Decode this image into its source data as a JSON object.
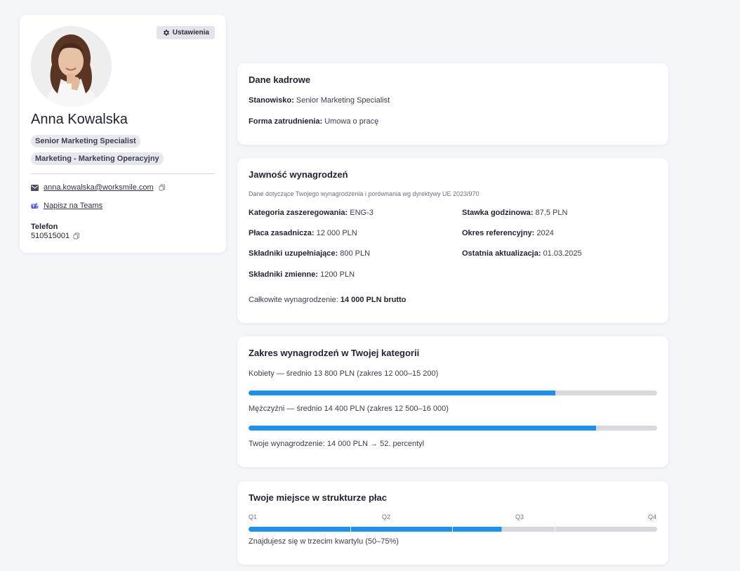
{
  "profile": {
    "settings_label": "Ustawienia",
    "name": "Anna Kowalska",
    "position_chip": "Senior Marketing Specialist",
    "department_chip": "Marketing - Marketing Operacyjny",
    "email": "anna.kowalska@worksmile.com",
    "teams_label": "Napisz na Teams",
    "phone_label": "Telefon",
    "phone": "510515001"
  },
  "hr_data": {
    "title": "Dane kadrowe",
    "position_key": "Stanowisko:",
    "position_value": "Senior Marketing Specialist",
    "employment_key": "Forma zatrudnienia:",
    "employment_value": "Umowa o pracę"
  },
  "pay_transparency": {
    "title": "Jawność wynagrodzeń",
    "note": "Dane dotyczące Twojego wynagrodzenia i porównania wg dyrektywy UE 2023/970",
    "category_key": "Kategoria zaszeregowania:",
    "category_value": "ENG-3",
    "hourly_key": "Stawka godzinowa:",
    "hourly_value": "87,5 PLN",
    "base_key": "Płaca zasadnicza:",
    "base_value": "12 000 PLN",
    "period_key": "Okres referencyjny:",
    "period_value": "2024",
    "supplementary_key": "Składniki uzupełniające:",
    "supplementary_value": "800 PLN",
    "updated_key": "Ostatnia aktualizacja:",
    "updated_value": "01.03.2025",
    "variable_key": "Składniki zmienne:",
    "variable_value": "1200 PLN",
    "total_key": "Całkowite wynagrodzenie:",
    "total_value": "14 000 PLN brutto"
  },
  "pay_range": {
    "title": "Zakres wynagrodzeń w Twojej kategorii",
    "women_label": "Kobiety — średnio 13 800 PLN (zakres 12 000–15 200)",
    "women_fill_fraction": 0.75,
    "men_label": "Mężczyźni — średnio 14 400 PLN (zakres 12 500–16 000)",
    "men_fill_fraction": 0.85,
    "yours_label": "Twoje wynagrodzenie: 14 000 PLN → 52. percentyl"
  },
  "structure": {
    "title": "Twoje miejsce w strukturze płac",
    "q1": "Q1",
    "q2": "Q2",
    "q3": "Q3",
    "q4": "Q4",
    "fill_fraction": 0.62,
    "caption": "Znajdujesz się w trzecim kwartylu (50–75%)"
  },
  "colors": {
    "accent": "#1e90e6",
    "track": "#d8d9de",
    "background": "#f4f5f8"
  }
}
